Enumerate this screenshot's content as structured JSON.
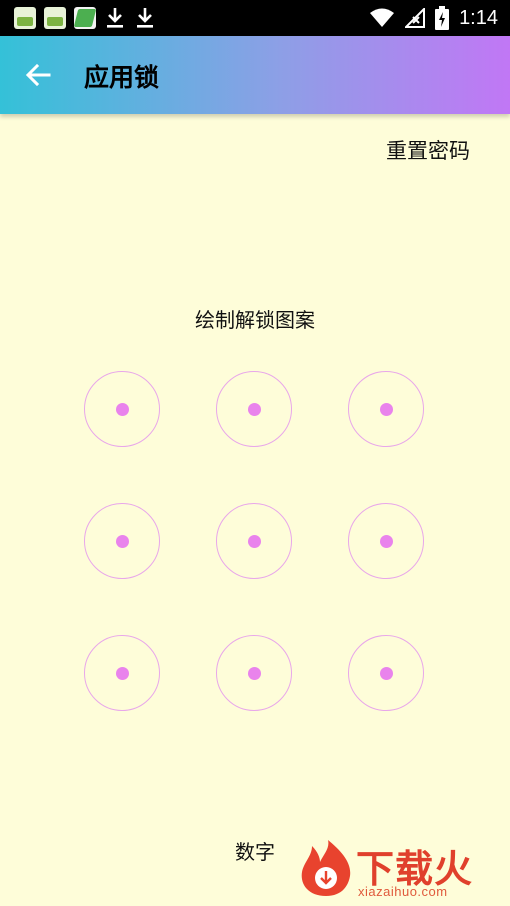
{
  "status_bar": {
    "time": "1:14",
    "icons": [
      "gallery-app-icon",
      "gallery-app-icon",
      "green-app-icon",
      "download-icon",
      "download-icon",
      "wifi-icon",
      "signal-icon",
      "battery-icon"
    ]
  },
  "toolbar": {
    "back_icon": "back-arrow-icon",
    "title": "应用锁"
  },
  "reset_password_label": "重置密码",
  "pattern_hint": "绘制解锁图案",
  "pattern": {
    "rows": 3,
    "columns": 3,
    "node_color": "#e983ec",
    "ring_color": "#e8a6ea"
  },
  "digit_button_label": "数字",
  "colors": {
    "background": "#fefdd9",
    "toolbar_gradient_start": "#34c1d8",
    "toolbar_gradient_end": "#c177f5"
  },
  "watermark": {
    "brand": "下载火",
    "domain": "xiazaihuo.com"
  }
}
